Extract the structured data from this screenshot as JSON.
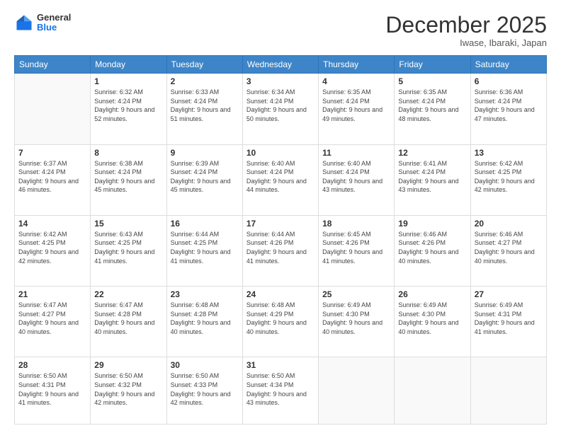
{
  "header": {
    "logo_general": "General",
    "logo_blue": "Blue",
    "month_title": "December 2025",
    "location": "Iwase, Ibaraki, Japan"
  },
  "days_of_week": [
    "Sunday",
    "Monday",
    "Tuesday",
    "Wednesday",
    "Thursday",
    "Friday",
    "Saturday"
  ],
  "weeks": [
    [
      {
        "day": "",
        "sunrise": "",
        "sunset": "",
        "daylight": ""
      },
      {
        "day": "1",
        "sunrise": "Sunrise: 6:32 AM",
        "sunset": "Sunset: 4:24 PM",
        "daylight": "Daylight: 9 hours and 52 minutes."
      },
      {
        "day": "2",
        "sunrise": "Sunrise: 6:33 AM",
        "sunset": "Sunset: 4:24 PM",
        "daylight": "Daylight: 9 hours and 51 minutes."
      },
      {
        "day": "3",
        "sunrise": "Sunrise: 6:34 AM",
        "sunset": "Sunset: 4:24 PM",
        "daylight": "Daylight: 9 hours and 50 minutes."
      },
      {
        "day": "4",
        "sunrise": "Sunrise: 6:35 AM",
        "sunset": "Sunset: 4:24 PM",
        "daylight": "Daylight: 9 hours and 49 minutes."
      },
      {
        "day": "5",
        "sunrise": "Sunrise: 6:35 AM",
        "sunset": "Sunset: 4:24 PM",
        "daylight": "Daylight: 9 hours and 48 minutes."
      },
      {
        "day": "6",
        "sunrise": "Sunrise: 6:36 AM",
        "sunset": "Sunset: 4:24 PM",
        "daylight": "Daylight: 9 hours and 47 minutes."
      }
    ],
    [
      {
        "day": "7",
        "sunrise": "Sunrise: 6:37 AM",
        "sunset": "Sunset: 4:24 PM",
        "daylight": "Daylight: 9 hours and 46 minutes."
      },
      {
        "day": "8",
        "sunrise": "Sunrise: 6:38 AM",
        "sunset": "Sunset: 4:24 PM",
        "daylight": "Daylight: 9 hours and 45 minutes."
      },
      {
        "day": "9",
        "sunrise": "Sunrise: 6:39 AM",
        "sunset": "Sunset: 4:24 PM",
        "daylight": "Daylight: 9 hours and 45 minutes."
      },
      {
        "day": "10",
        "sunrise": "Sunrise: 6:40 AM",
        "sunset": "Sunset: 4:24 PM",
        "daylight": "Daylight: 9 hours and 44 minutes."
      },
      {
        "day": "11",
        "sunrise": "Sunrise: 6:40 AM",
        "sunset": "Sunset: 4:24 PM",
        "daylight": "Daylight: 9 hours and 43 minutes."
      },
      {
        "day": "12",
        "sunrise": "Sunrise: 6:41 AM",
        "sunset": "Sunset: 4:24 PM",
        "daylight": "Daylight: 9 hours and 43 minutes."
      },
      {
        "day": "13",
        "sunrise": "Sunrise: 6:42 AM",
        "sunset": "Sunset: 4:25 PM",
        "daylight": "Daylight: 9 hours and 42 minutes."
      }
    ],
    [
      {
        "day": "14",
        "sunrise": "Sunrise: 6:42 AM",
        "sunset": "Sunset: 4:25 PM",
        "daylight": "Daylight: 9 hours and 42 minutes."
      },
      {
        "day": "15",
        "sunrise": "Sunrise: 6:43 AM",
        "sunset": "Sunset: 4:25 PM",
        "daylight": "Daylight: 9 hours and 41 minutes."
      },
      {
        "day": "16",
        "sunrise": "Sunrise: 6:44 AM",
        "sunset": "Sunset: 4:25 PM",
        "daylight": "Daylight: 9 hours and 41 minutes."
      },
      {
        "day": "17",
        "sunrise": "Sunrise: 6:44 AM",
        "sunset": "Sunset: 4:26 PM",
        "daylight": "Daylight: 9 hours and 41 minutes."
      },
      {
        "day": "18",
        "sunrise": "Sunrise: 6:45 AM",
        "sunset": "Sunset: 4:26 PM",
        "daylight": "Daylight: 9 hours and 41 minutes."
      },
      {
        "day": "19",
        "sunrise": "Sunrise: 6:46 AM",
        "sunset": "Sunset: 4:26 PM",
        "daylight": "Daylight: 9 hours and 40 minutes."
      },
      {
        "day": "20",
        "sunrise": "Sunrise: 6:46 AM",
        "sunset": "Sunset: 4:27 PM",
        "daylight": "Daylight: 9 hours and 40 minutes."
      }
    ],
    [
      {
        "day": "21",
        "sunrise": "Sunrise: 6:47 AM",
        "sunset": "Sunset: 4:27 PM",
        "daylight": "Daylight: 9 hours and 40 minutes."
      },
      {
        "day": "22",
        "sunrise": "Sunrise: 6:47 AM",
        "sunset": "Sunset: 4:28 PM",
        "daylight": "Daylight: 9 hours and 40 minutes."
      },
      {
        "day": "23",
        "sunrise": "Sunrise: 6:48 AM",
        "sunset": "Sunset: 4:28 PM",
        "daylight": "Daylight: 9 hours and 40 minutes."
      },
      {
        "day": "24",
        "sunrise": "Sunrise: 6:48 AM",
        "sunset": "Sunset: 4:29 PM",
        "daylight": "Daylight: 9 hours and 40 minutes."
      },
      {
        "day": "25",
        "sunrise": "Sunrise: 6:49 AM",
        "sunset": "Sunset: 4:30 PM",
        "daylight": "Daylight: 9 hours and 40 minutes."
      },
      {
        "day": "26",
        "sunrise": "Sunrise: 6:49 AM",
        "sunset": "Sunset: 4:30 PM",
        "daylight": "Daylight: 9 hours and 40 minutes."
      },
      {
        "day": "27",
        "sunrise": "Sunrise: 6:49 AM",
        "sunset": "Sunset: 4:31 PM",
        "daylight": "Daylight: 9 hours and 41 minutes."
      }
    ],
    [
      {
        "day": "28",
        "sunrise": "Sunrise: 6:50 AM",
        "sunset": "Sunset: 4:31 PM",
        "daylight": "Daylight: 9 hours and 41 minutes."
      },
      {
        "day": "29",
        "sunrise": "Sunrise: 6:50 AM",
        "sunset": "Sunset: 4:32 PM",
        "daylight": "Daylight: 9 hours and 42 minutes."
      },
      {
        "day": "30",
        "sunrise": "Sunrise: 6:50 AM",
        "sunset": "Sunset: 4:33 PM",
        "daylight": "Daylight: 9 hours and 42 minutes."
      },
      {
        "day": "31",
        "sunrise": "Sunrise: 6:50 AM",
        "sunset": "Sunset: 4:34 PM",
        "daylight": "Daylight: 9 hours and 43 minutes."
      },
      {
        "day": "",
        "sunrise": "",
        "sunset": "",
        "daylight": ""
      },
      {
        "day": "",
        "sunrise": "",
        "sunset": "",
        "daylight": ""
      },
      {
        "day": "",
        "sunrise": "",
        "sunset": "",
        "daylight": ""
      }
    ]
  ]
}
